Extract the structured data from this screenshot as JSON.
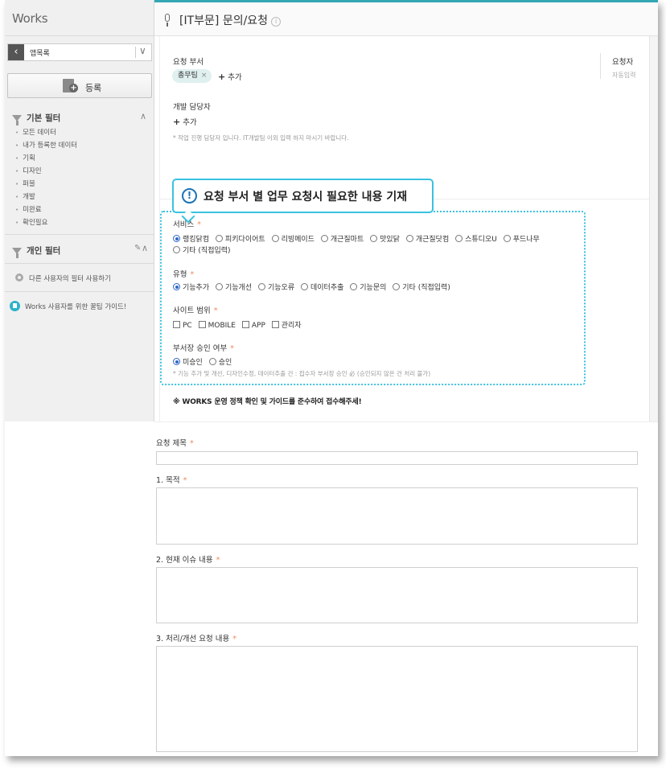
{
  "app": {
    "title": "Works"
  },
  "sidebar": {
    "app_selector_label": "앱목록",
    "back_glyph": "‹",
    "chevron_glyph": "∨",
    "register_label": "등록",
    "basic_filter": {
      "title": "기본 필터",
      "items": [
        "모든 데이터",
        "내가 등록한 데이터",
        "기획",
        "디자인",
        "퍼블",
        "개발",
        "미완료",
        "확인필요"
      ]
    },
    "personal_filter": {
      "title": "개인 필터"
    },
    "other_user_filter": "다른 사용자의 필터 사용하기",
    "guide_link": "Works 사용자를 위한 꿀팁 가이드!",
    "caret_up": "∧",
    "pencil_glyph": "✎"
  },
  "header": {
    "title": "[IT부문] 문의/요청",
    "info_glyph": "i"
  },
  "form": {
    "request_dept": {
      "label": "요청 부서",
      "chip": "총무팀",
      "chip_x": "×",
      "add_label": "추가"
    },
    "requester": {
      "label": "요청자",
      "value": "자동입력"
    },
    "developer": {
      "label": "개발 담당자",
      "add_label": "추가",
      "help": "* 작업 진행 담당자 입니다. IT개발팀 이외 입력 하지 마시기 바랍니다."
    },
    "callout": "요청 부서 별 업무 요청시 필요한 내용 기재",
    "service": {
      "label": "서비스",
      "required": "*",
      "options": [
        "랭킹닭컴",
        "피키다이어트",
        "리빙메이드",
        "개근질마트",
        "맛있닭",
        "개근질닷컴",
        "스튜디오U",
        "푸드나무"
      ],
      "options_row2": [
        "기타 (직접입력)"
      ],
      "selected": "랭킹닭컴"
    },
    "type": {
      "label": "유형",
      "required": "*",
      "options": [
        "기능추가",
        "기능개선",
        "기능오류",
        "데이터추출",
        "기능문의",
        "기타 (직접입력)"
      ],
      "selected": "기능추가"
    },
    "site_scope": {
      "label": "사이트 범위",
      "required": "*",
      "options": [
        "PC",
        "MOBILE",
        "APP",
        "관리자"
      ]
    },
    "approval": {
      "label": "부서장 승인 여부",
      "required": "*",
      "options": [
        "미승인",
        "승인"
      ],
      "selected": "미승인",
      "help": "* 기능 추가 및 개선, 디자인수정, 데이터추출 건 : 접수자 부서장 승인 必 (승인되지 않은 건 처리 불가)"
    },
    "policy_note": "※ WORKS 운영 정책 확인 및 가이드를 준수하여 접수해주세!",
    "title_field": {
      "label": "요청 제목",
      "required": "*",
      "value": ""
    },
    "purpose": {
      "label": "1. 목적",
      "required": "*",
      "value": ""
    },
    "issue": {
      "label": "2. 현재 이슈 내용",
      "required": "*",
      "value": ""
    },
    "request_content": {
      "label": "3. 처리/개선 요청 내용",
      "required": "*",
      "value": ""
    }
  },
  "colors": {
    "accent": "#34a7b5",
    "highlight": "#39c2e0",
    "required": "#f08a5a",
    "radio_on": "#2f67c7"
  }
}
